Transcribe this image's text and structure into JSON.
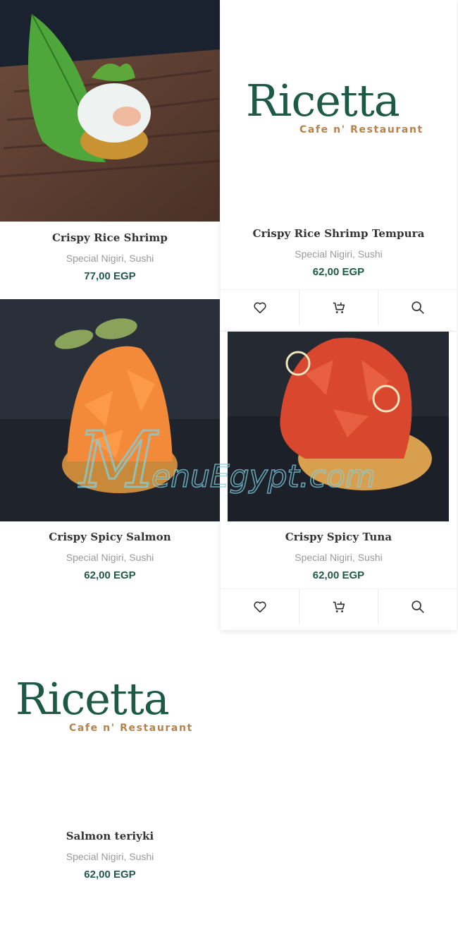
{
  "watermark_text": "MenuEgypt.com",
  "colors": {
    "brand_green": "#1e5a45",
    "brand_tan": "#b8814b",
    "category_grey": "#9a9a9a"
  },
  "products": [
    {
      "title": "Crispy Rice Shrimp",
      "categories": "Special Nigiri, Sushi",
      "price": "77,00 EGP"
    },
    {
      "title": "Crispy Rice Shrimp Tempura",
      "categories": "Special Nigiri, Sushi",
      "price": "62,00 EGP",
      "logo": {
        "word": "Ricetta",
        "sub": "Cafe n' Restaurant"
      }
    },
    {
      "title": "Crispy Spicy Salmon",
      "categories": "Special Nigiri, Sushi",
      "price": "62,00 EGP"
    },
    {
      "title": "Crispy Spicy Tuna",
      "categories": "Special Nigiri, Sushi",
      "price": "62,00 EGP"
    },
    {
      "title": "Salmon teriyki",
      "categories": "Special Nigiri, Sushi",
      "price": "62,00 EGP",
      "logo": {
        "word": "Ricetta",
        "sub": "Cafe n' Restaurant"
      }
    }
  ],
  "action_icons": [
    "heart-icon",
    "cart-icon",
    "search-icon"
  ]
}
